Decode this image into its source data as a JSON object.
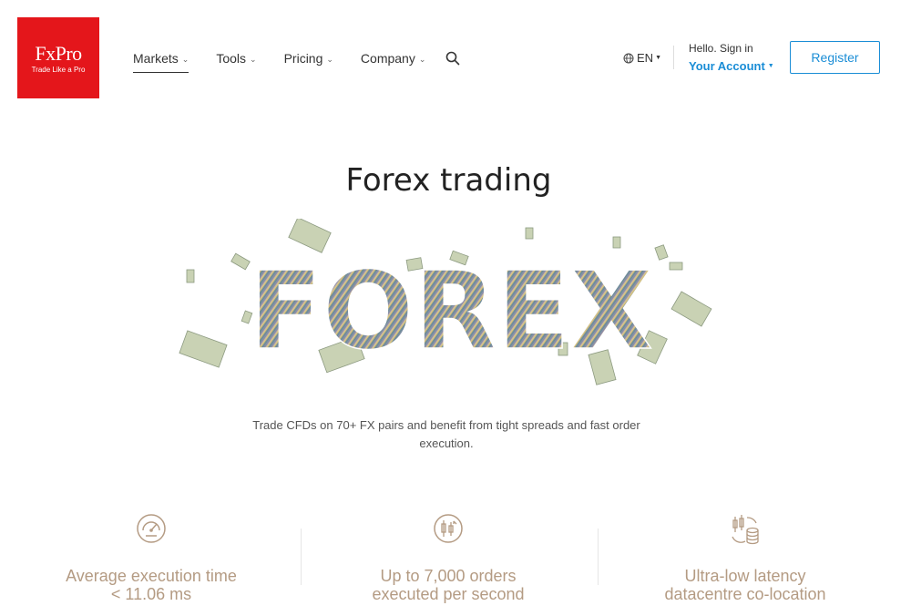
{
  "logo": {
    "name": "FxPro",
    "tagline": "Trade Like a Pro"
  },
  "nav": [
    {
      "label": "Markets"
    },
    {
      "label": "Tools"
    },
    {
      "label": "Pricing"
    },
    {
      "label": "Company"
    }
  ],
  "header": {
    "language": "EN",
    "hello": "Hello. Sign in",
    "account": "Your Account",
    "register": "Register"
  },
  "hero": {
    "title": "Forex trading",
    "art_word": "FOREX",
    "description": "Trade CFDs on 70+ FX pairs and benefit from tight spreads and fast order execution."
  },
  "features": [
    {
      "icon": "speedometer-icon",
      "line1": "Average execution time",
      "line2": "< 11.06 ms"
    },
    {
      "icon": "candlestick-icon",
      "line1": "Up to 7,000 orders",
      "line2": "executed per second"
    },
    {
      "icon": "datacentre-icon",
      "line1": "Ultra-low latency",
      "line2": "datacentre co-location"
    }
  ],
  "colors": {
    "brand": "#e4161b",
    "accent": "#1a8dd6",
    "feature_text": "#b49b83"
  }
}
